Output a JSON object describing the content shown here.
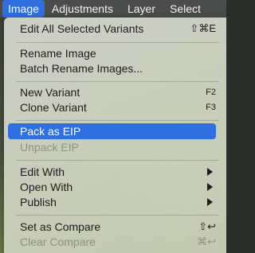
{
  "menubar": {
    "items": [
      {
        "label": "Image"
      },
      {
        "label": "Adjustments"
      },
      {
        "label": "Layer"
      },
      {
        "label": "Select"
      }
    ]
  },
  "menu": {
    "edit_all_variants": {
      "label": "Edit All Selected Variants",
      "shortcut": "⇧⌘E"
    },
    "rename_image": {
      "label": "Rename Image"
    },
    "batch_rename": {
      "label": "Batch Rename Images..."
    },
    "new_variant": {
      "label": "New Variant",
      "shortcut": "F2"
    },
    "clone_variant": {
      "label": "Clone Variant",
      "shortcut": "F3"
    },
    "pack_as_eip": {
      "label": "Pack as EIP"
    },
    "unpack_eip": {
      "label": "Unpack EIP"
    },
    "edit_with": {
      "label": "Edit With"
    },
    "open_with": {
      "label": "Open With"
    },
    "publish": {
      "label": "Publish"
    },
    "set_as_compare": {
      "label": "Set as Compare",
      "shortcut": "⇧↩"
    },
    "clear_compare": {
      "label": "Clear Compare",
      "shortcut": "⌘↩"
    }
  }
}
